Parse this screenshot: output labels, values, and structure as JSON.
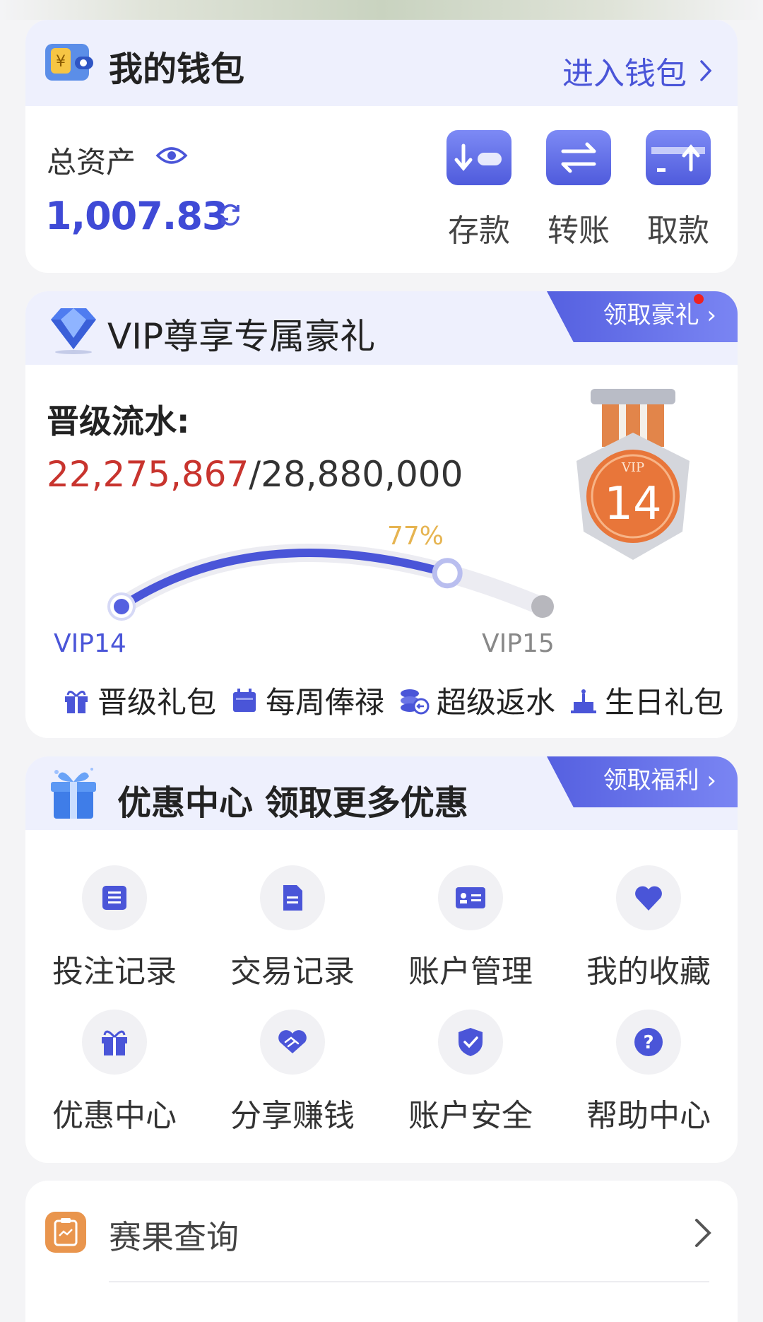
{
  "wallet": {
    "title": "我的钱包",
    "enter_label": "进入钱包",
    "total_label": "总资产",
    "balance": "1,007.83",
    "actions": [
      {
        "label": "存款",
        "icon": "deposit-icon"
      },
      {
        "label": "转账",
        "icon": "transfer-icon"
      },
      {
        "label": "取款",
        "icon": "withdraw-icon"
      }
    ]
  },
  "vip": {
    "title": "VIP尊享专属豪礼",
    "claim_label": "领取豪礼",
    "promotion_label": "晋级流水:",
    "turnover_current": "22,275,867",
    "turnover_target": "/28,880,000",
    "progress_percent": 77,
    "progress_text": "77%",
    "current_level": "VIP14",
    "next_level": "VIP15",
    "medal_level": "14",
    "medal_tag": "VIP",
    "perks": [
      {
        "label": "晋级礼包",
        "icon": "gift-icon"
      },
      {
        "label": "每周俸禄",
        "icon": "calendar-icon"
      },
      {
        "label": "超级返水",
        "icon": "coins-icon"
      },
      {
        "label": "生日礼包",
        "icon": "cake-icon"
      }
    ]
  },
  "promotions": {
    "title": "优惠中心 领取更多优惠",
    "claim_label": "领取福利",
    "items": [
      {
        "label": "投注记录",
        "icon": "betting-record-icon"
      },
      {
        "label": "交易记录",
        "icon": "transaction-record-icon"
      },
      {
        "label": "账户管理",
        "icon": "id-card-icon"
      },
      {
        "label": "我的收藏",
        "icon": "heart-icon"
      },
      {
        "label": "优惠中心",
        "icon": "gift-icon"
      },
      {
        "label": "分享赚钱",
        "icon": "handshake-icon"
      },
      {
        "label": "账户安全",
        "icon": "shield-icon"
      },
      {
        "label": "帮助中心",
        "icon": "help-icon"
      }
    ]
  },
  "results": {
    "label": "赛果查询"
  },
  "colors": {
    "accent": "#4a55d8",
    "highlight_red": "#c8342e",
    "percent_gold": "#e6b451"
  }
}
